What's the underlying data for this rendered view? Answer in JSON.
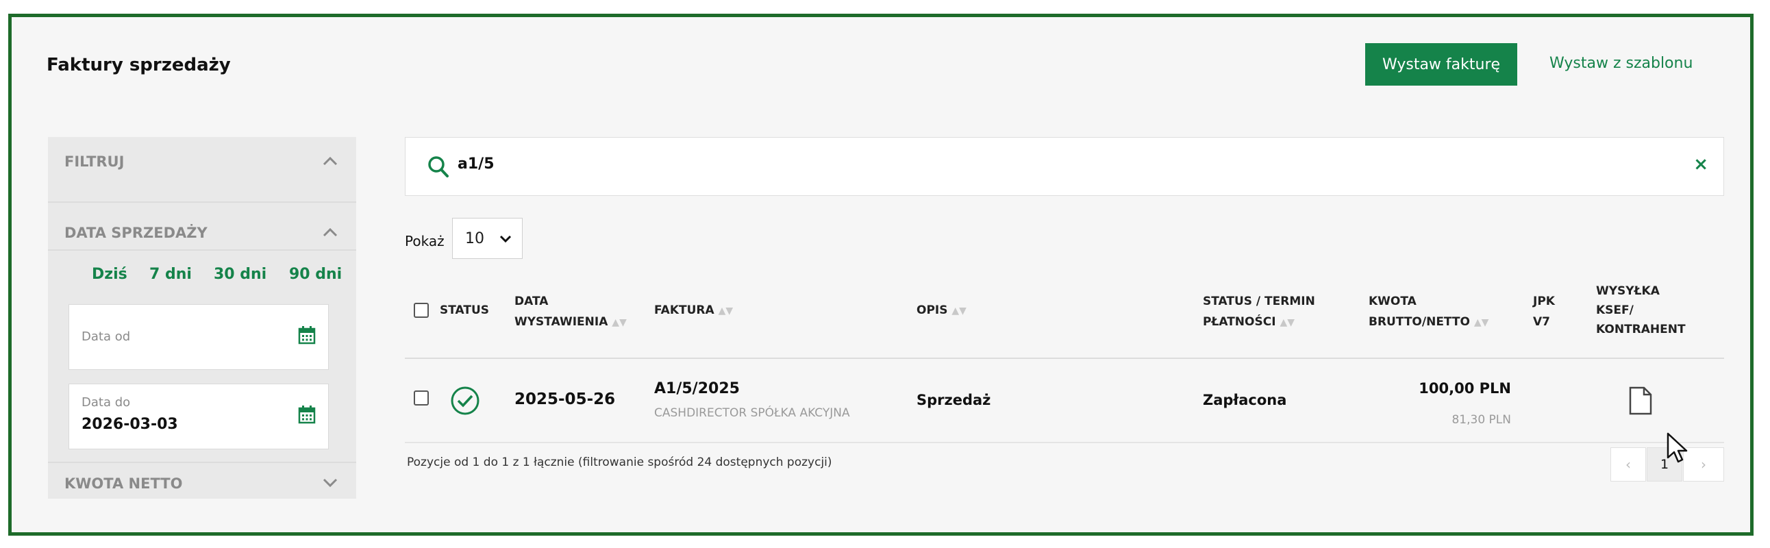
{
  "page": {
    "title": "Faktury sprzedaży"
  },
  "actions": {
    "primary_label": "Wystaw fakturę",
    "template_label": "Wystaw z szablonu"
  },
  "filters": {
    "section_label": "FILTRUJ",
    "date_section_label": "DATA SPRZEDAŻY",
    "quick_ranges": [
      "Dziś",
      "7 dni",
      "30 dni",
      "90 dni"
    ],
    "date_from": {
      "label": "Data od",
      "value": ""
    },
    "date_to": {
      "label": "Data do",
      "value": "2026-03-03"
    },
    "amount_section_label": "KWOTA NETTO"
  },
  "search": {
    "query": "a1/5",
    "clear_symbol": "×"
  },
  "show": {
    "label": "Pokaż",
    "value": "10"
  },
  "table": {
    "headers": {
      "status": "STATUS",
      "date": [
        "DATA",
        "WYSTAWIENIA"
      ],
      "invoice": "FAKTURA",
      "desc": "OPIS",
      "payment": [
        "STATUS / TERMIN",
        "PŁATNOŚCI"
      ],
      "amount": [
        "KWOTA",
        "BRUTTO/NETTO"
      ],
      "jpk": [
        "JPK",
        "V7"
      ],
      "ksef": [
        "WYSYŁKA",
        "KSEF/",
        "KONTRAHENT"
      ]
    },
    "rows": [
      {
        "date": "2025-05-26",
        "invoice": "A1/5/2025",
        "contractor": "CASHDIRECTOR SPÓŁKA AKCYJNA",
        "desc": "Sprzedaż",
        "payment_status": "Zapłacona",
        "gross": "100,00 PLN",
        "net": "81,30 PLN"
      }
    ]
  },
  "footer": {
    "summary": "Pozycje od 1 do 1 z 1 łącznie (filtrowanie spośród 24 dostępnych pozycji)"
  },
  "pagination": {
    "prev": "‹",
    "current": "1",
    "next": "›"
  },
  "colors": {
    "accent": "#15834a",
    "frame": "#1e6b2a",
    "background": "#f6f6f6"
  }
}
